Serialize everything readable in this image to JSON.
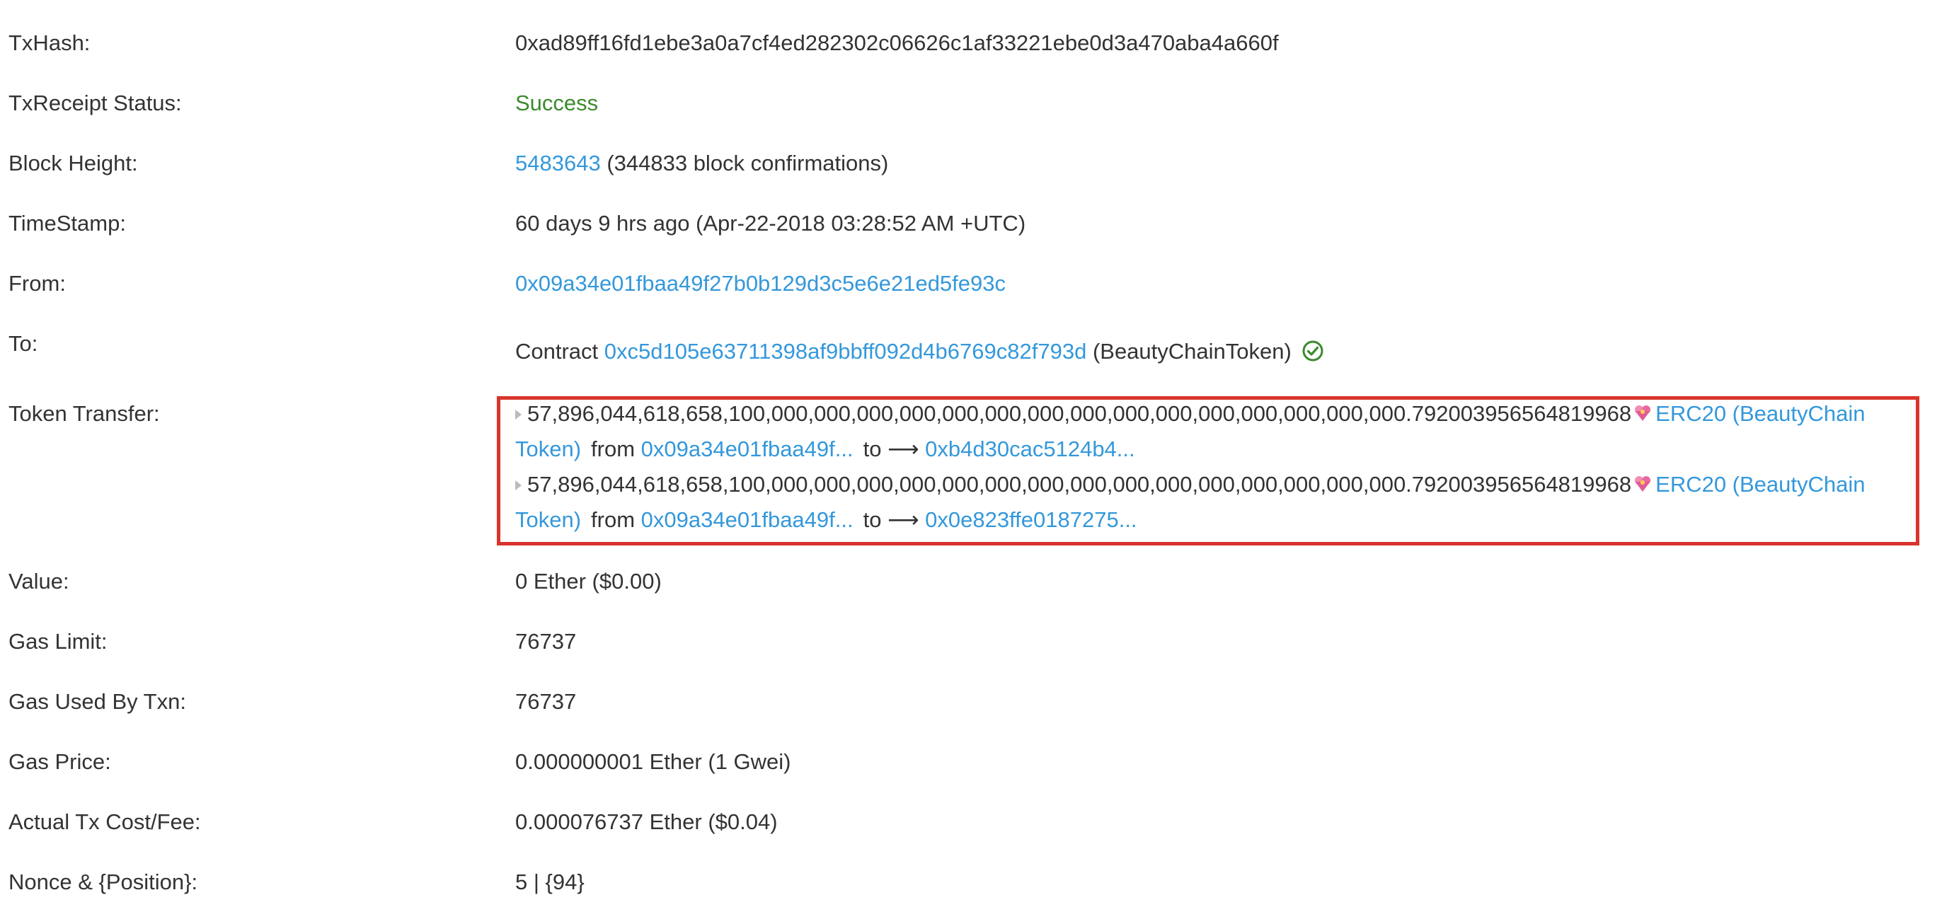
{
  "fields": {
    "txhash": {
      "label": "TxHash:",
      "value": "0xad89ff16fd1ebe3a0a7cf4ed282302c06626c1af33221ebe0d3a470aba4a660f"
    },
    "status": {
      "label": "TxReceipt Status:",
      "value": "Success"
    },
    "block": {
      "label": "Block Height:",
      "number": "5483643",
      "confirmations": "(344833 block confirmations)"
    },
    "timestamp": {
      "label": "TimeStamp:",
      "value": "60 days 9 hrs ago (Apr-22-2018 03:28:52 AM +UTC)"
    },
    "from": {
      "label": "From:",
      "value": "0x09a34e01fbaa49f27b0b129d3c5e6e21ed5fe93c"
    },
    "to": {
      "label": "To:",
      "prefix": "Contract",
      "address": "0xc5d105e63711398af9bbff092d4b6769c82f793d",
      "name": "(BeautyChainToken)"
    },
    "token_transfer": {
      "label": "Token Transfer:"
    },
    "value": {
      "label": "Value:",
      "value": "0 Ether ($0.00)"
    },
    "gas_limit": {
      "label": "Gas Limit:",
      "value": "76737"
    },
    "gas_used": {
      "label": "Gas Used By Txn:",
      "value": "76737"
    },
    "gas_price": {
      "label": "Gas Price:",
      "value": "0.000000001 Ether (1 Gwei)"
    },
    "tx_fee": {
      "label": "Actual Tx Cost/Fee:",
      "value": "0.000076737 Ether ($0.04)"
    },
    "nonce": {
      "label": "Nonce & {Position}:",
      "value": "5 | {94}"
    }
  },
  "transfers": [
    {
      "amount": "57,896,044,618,658,100,000,000,000,000,000,000,000,000,000,000,000,000,000,000,000.792003956564819968",
      "token_part1": "ERC20 (BeautyChain",
      "token_part2": "Token)",
      "from_word": "from",
      "from_address": "0x09a34e01fbaa49f...",
      "to_word": "to",
      "arrow": "⟶",
      "to_address": "0xb4d30cac5124b4..."
    },
    {
      "amount": "57,896,044,618,658,100,000,000,000,000,000,000,000,000,000,000,000,000,000,000,000.792003956564819968",
      "token_part1": "ERC20 (BeautyChain",
      "token_part2": "Token)",
      "from_word": "from",
      "from_address": "0x09a34e01fbaa49f...",
      "to_word": "to",
      "arrow": "⟶",
      "to_address": "0x0e823ffe0187275..."
    }
  ],
  "colors": {
    "link": "#3498db",
    "success": "#3c8a2e",
    "highlight_border": "#d9342b",
    "text": "#333333"
  },
  "icons": {
    "verified": "check-circle-icon",
    "token": "token-heart-icon",
    "expand": "caret-right-icon"
  }
}
